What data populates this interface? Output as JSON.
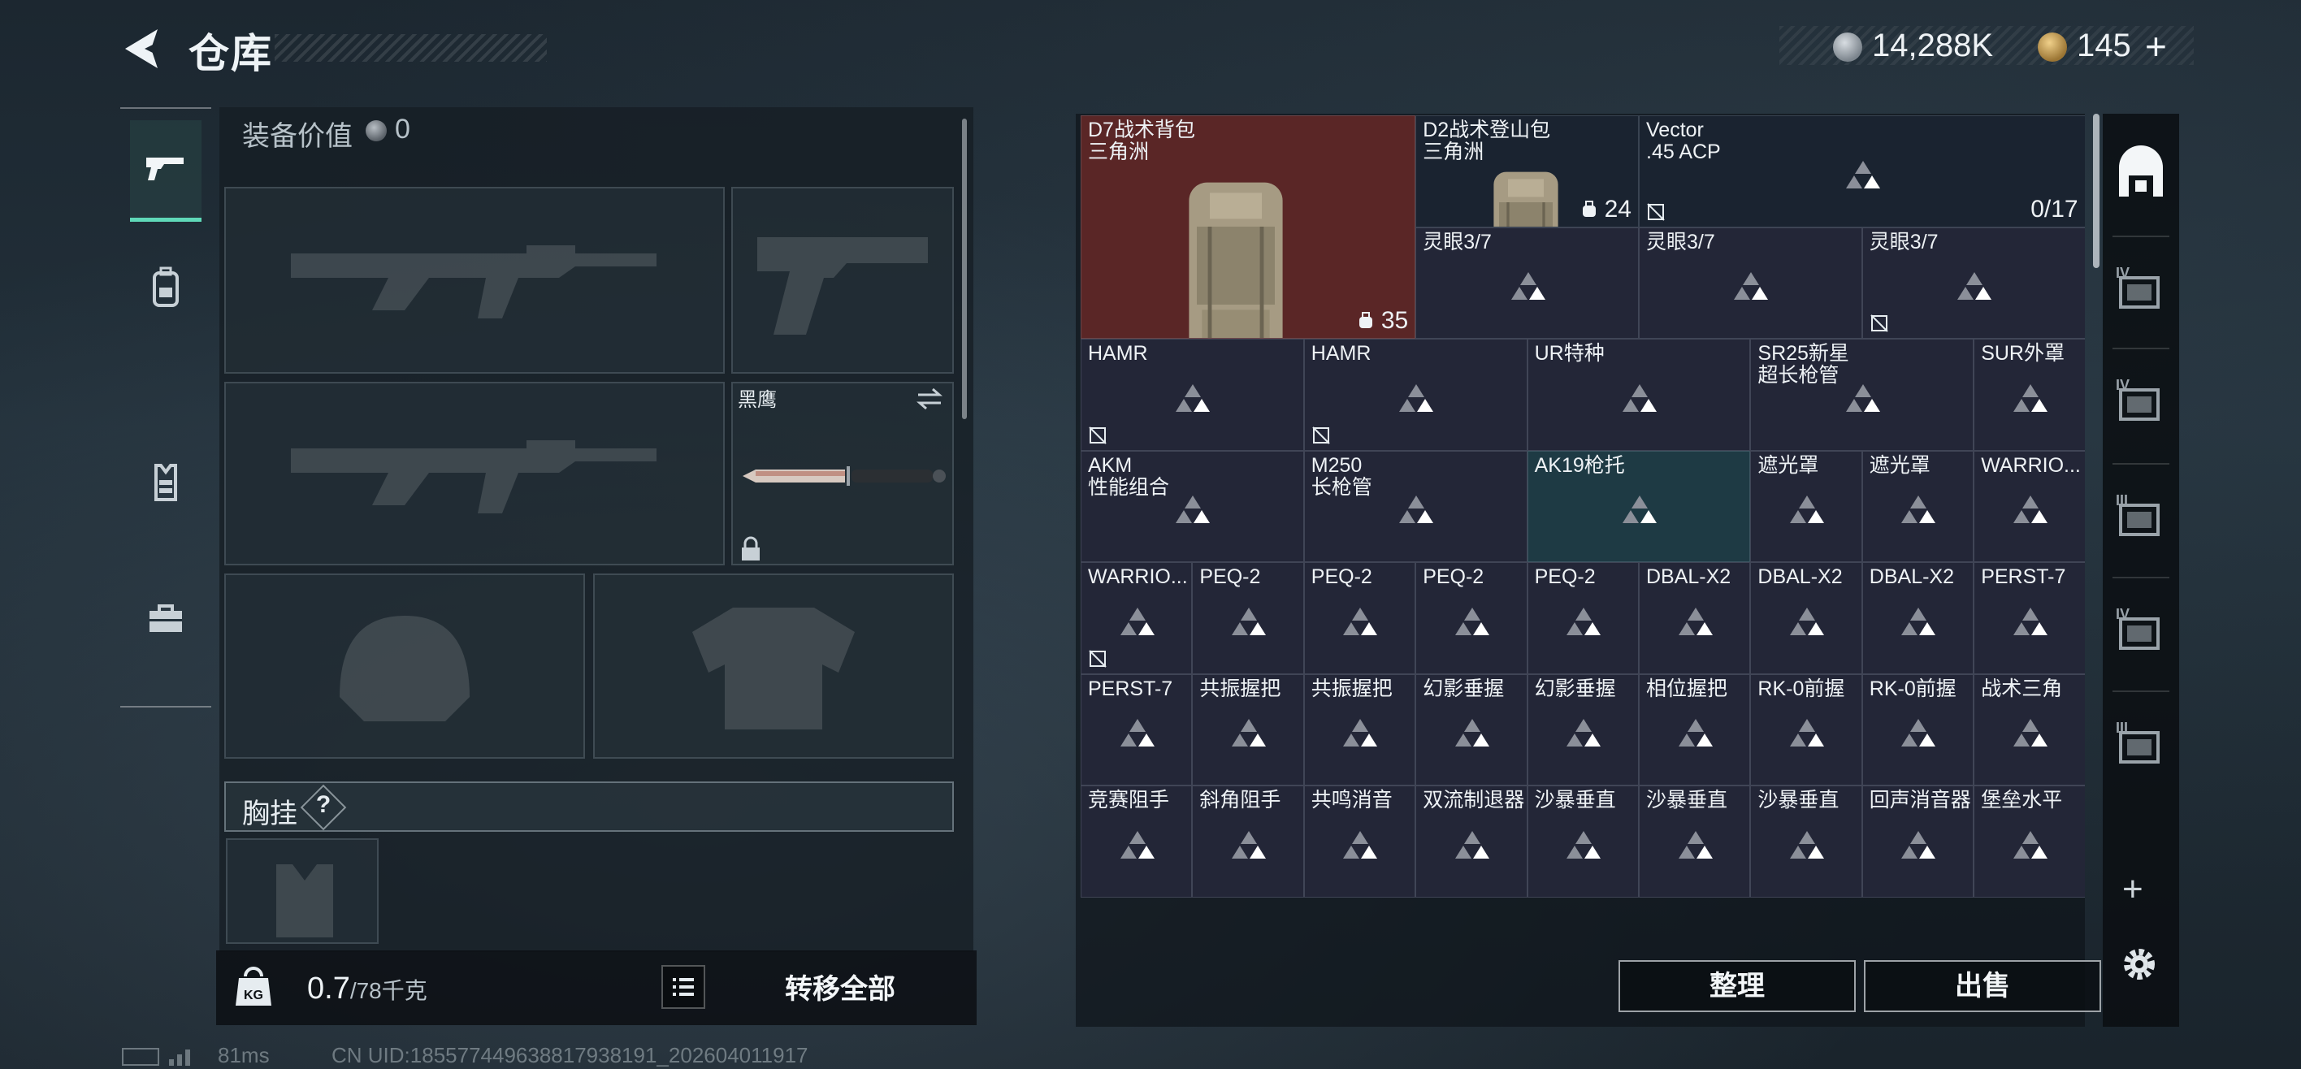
{
  "header": {
    "title": "仓库",
    "silver_amount": "14,288K",
    "gold_amount": "145",
    "plus": "+"
  },
  "categories": [
    {
      "icon": "pistol-icon",
      "active": true
    },
    {
      "icon": "backpack-icon",
      "active": false
    },
    {
      "icon": "vest-icon",
      "active": false
    },
    {
      "icon": "toolbox-icon",
      "active": false
    }
  ],
  "equipment": {
    "value_label": "装备价值",
    "value": "0",
    "knife_name": "黑鹰",
    "chest_label": "胸挂",
    "help": "?",
    "weight_current": "0.7",
    "weight_max": "/78千克",
    "transfer_all": "转移全部"
  },
  "grid_items": [
    {
      "label": "D7战术背包\n三角洲",
      "count": "35",
      "kind": "bag"
    },
    {
      "label": "D2战术登山包\n三角洲",
      "count": "24",
      "kind": "bag2"
    },
    {
      "label": "Vector\n.45 ACP",
      "count": "0/17",
      "kind": "gun"
    },
    {
      "label": "灵眼3/7"
    },
    {
      "label": "灵眼3/7"
    },
    {
      "label": "灵眼3/7"
    },
    {
      "label": "HAMR"
    },
    {
      "label": "HAMR"
    },
    {
      "label": "UR特种"
    },
    {
      "label": "SR25新星\n超长枪管"
    },
    {
      "label": "SUR外罩"
    },
    {
      "label": "AKM\n性能组合"
    },
    {
      "label": "M250\n长枪管"
    },
    {
      "label": "AK19枪托"
    },
    {
      "label": "遮光罩"
    },
    {
      "label": "遮光罩"
    },
    {
      "label": "WARRIO..."
    },
    {
      "label": "WARRIO..."
    },
    {
      "label": "PEQ-2"
    },
    {
      "label": "PEQ-2"
    },
    {
      "label": "PEQ-2"
    },
    {
      "label": "PEQ-2"
    },
    {
      "label": "DBAL-X2"
    },
    {
      "label": "DBAL-X2"
    },
    {
      "label": "DBAL-X2"
    },
    {
      "label": "PERST-7"
    },
    {
      "label": "PERST-7"
    },
    {
      "label": "共振握把"
    },
    {
      "label": "共振握把"
    },
    {
      "label": "幻影垂握"
    },
    {
      "label": "幻影垂握"
    },
    {
      "label": "相位握把"
    },
    {
      "label": "RK-0前握"
    },
    {
      "label": "RK-0前握"
    },
    {
      "label": "战术三角"
    },
    {
      "label": "竞赛阻手"
    },
    {
      "label": "斜角阻手"
    },
    {
      "label": "共鸣消音"
    },
    {
      "label": "双流制退器"
    },
    {
      "label": "沙暴垂直"
    },
    {
      "label": "沙暴垂直"
    },
    {
      "label": "沙暴垂直"
    },
    {
      "label": "回声消音器"
    },
    {
      "label": "堡垒水平"
    }
  ],
  "actions": {
    "sort": "整理",
    "sell": "出售"
  },
  "right_rail": [
    {
      "icon": "storage-home-icon",
      "tier": ""
    },
    {
      "icon": "storage-case-icon",
      "tier": "IV"
    },
    {
      "icon": "storage-case-icon",
      "tier": "IV"
    },
    {
      "icon": "storage-case-icon",
      "tier": "III"
    },
    {
      "icon": "storage-case-icon",
      "tier": "IV"
    },
    {
      "icon": "storage-case-icon",
      "tier": "III"
    }
  ],
  "status": {
    "ping": "81ms",
    "uid": "CN UID:185577449638817938191_202604011917"
  }
}
